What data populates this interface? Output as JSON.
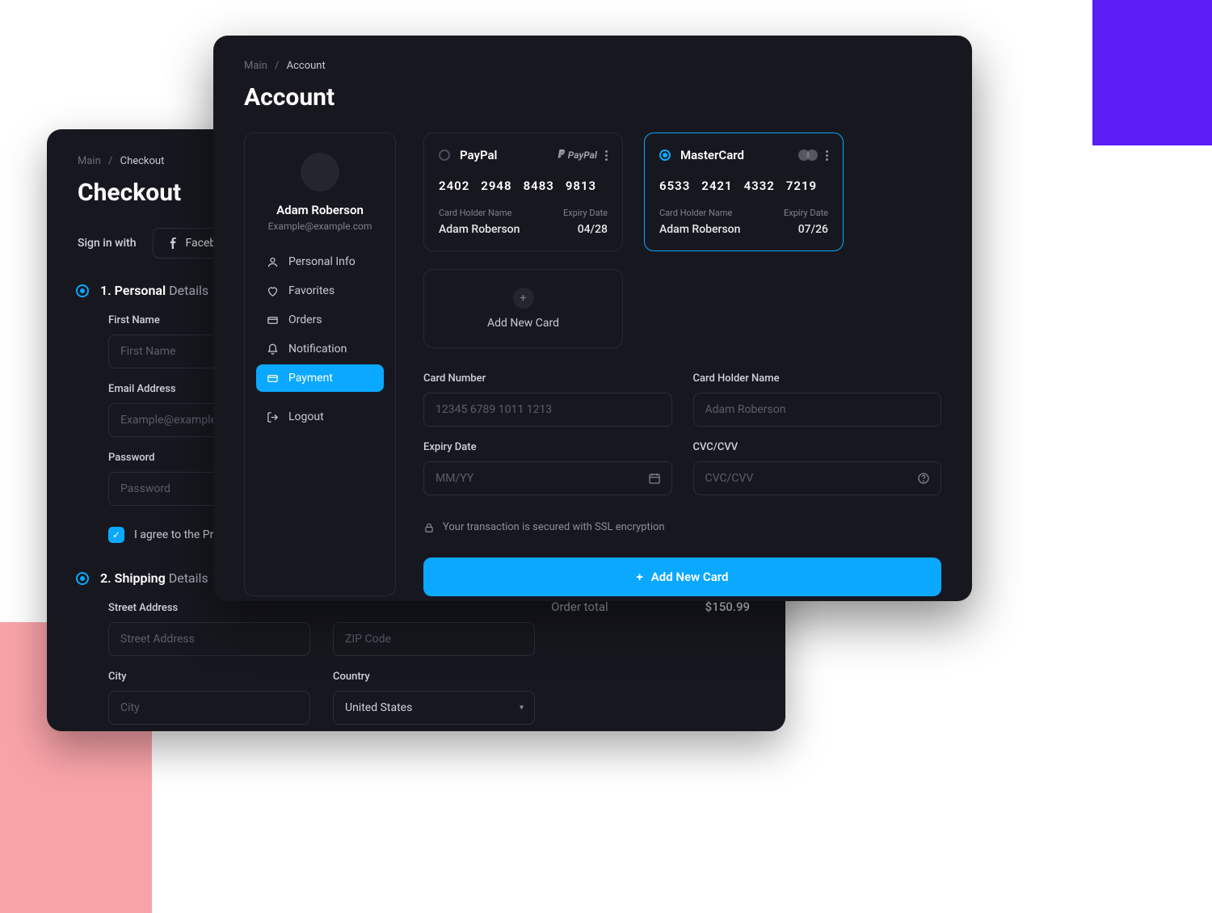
{
  "checkout": {
    "breadcrumb": {
      "root": "Main",
      "current": "Checkout"
    },
    "title": "Checkout",
    "signin_label": "Sign in with",
    "social": {
      "facebook": "Facebook"
    },
    "steps": {
      "s1": {
        "num": "1.",
        "bold": "Personal",
        "thin": "Details"
      },
      "s2": {
        "num": "2.",
        "bold": "Shipping",
        "thin": "Details"
      }
    },
    "fields": {
      "first_name": {
        "label": "First Name",
        "ph": "First Name"
      },
      "email": {
        "label": "Email Address",
        "ph": "Example@example.com"
      },
      "password": {
        "label": "Password",
        "ph": "Password"
      },
      "street": {
        "label": "Street Address",
        "ph": "Street Address"
      },
      "zip": {
        "label": "",
        "ph": "ZIP Code"
      },
      "city": {
        "label": "City",
        "ph": "City"
      },
      "country": {
        "label": "Country",
        "value": "United States"
      }
    },
    "agree": "I agree to the Privacy",
    "order": {
      "label": "Order total",
      "value": "$150.99"
    }
  },
  "account": {
    "breadcrumb": {
      "root": "Main",
      "current": "Account"
    },
    "title": "Account",
    "user": {
      "name": "Adam Roberson",
      "email": "Example@example.com"
    },
    "nav": {
      "personal": "Personal Info",
      "favorites": "Favorites",
      "orders": "Orders",
      "notification": "Notification",
      "payment": "Payment",
      "logout": "Logout"
    },
    "cards": [
      {
        "brand": "PayPal",
        "selected": false,
        "number": [
          "2402",
          "2948",
          "8483",
          "9813"
        ],
        "holder_label": "Card Holder Name",
        "holder": "Adam Roberson",
        "expiry_label": "Expiry Date",
        "expiry": "04/28"
      },
      {
        "brand": "MasterCard",
        "selected": true,
        "number": [
          "6533",
          "2421",
          "4332",
          "7219"
        ],
        "holder_label": "Card Holder Name",
        "holder": "Adam Roberson",
        "expiry_label": "Expiry Date",
        "expiry": "07/26"
      }
    ],
    "add_card_box": "Add New Card",
    "form": {
      "card_number": {
        "label": "Card Number",
        "ph": "12345 6789 1011 1213"
      },
      "holder": {
        "label": "Card Holder Name",
        "ph": "Adam Roberson"
      },
      "expiry": {
        "label": "Expiry Date",
        "ph": "MM/YY"
      },
      "cvv": {
        "label": "CVC/CVV",
        "ph": "CVC/CVV"
      }
    },
    "ssl": "Your transaction is secured with SSL encryption",
    "submit": "Add New Card"
  },
  "colors": {
    "accent": "#0aa8ff",
    "violet": "#5a1df5",
    "pink": "#f8a3a8"
  }
}
